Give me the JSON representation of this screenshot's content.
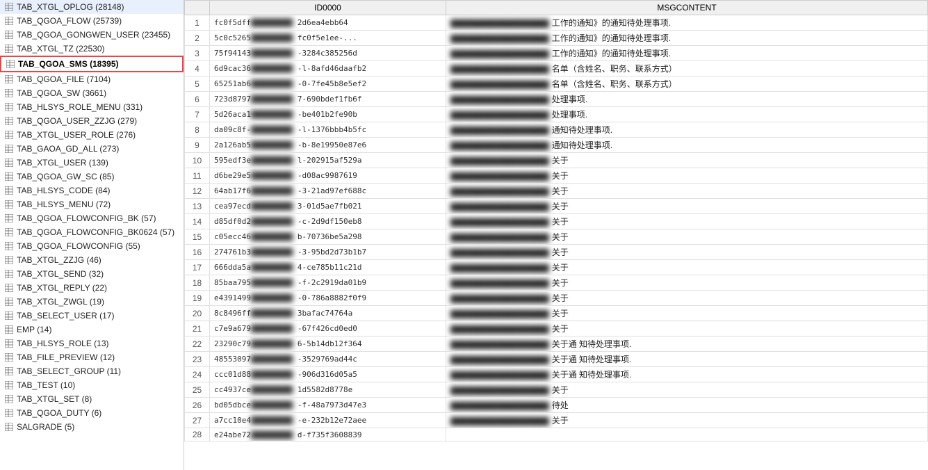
{
  "sidebar": {
    "items": [
      {
        "label": "TAB_XTGL_OPLOG (28148)",
        "selected": false
      },
      {
        "label": "TAB_QGOA_FLOW (25739)",
        "selected": false
      },
      {
        "label": "TAB_QGOA_GONGWEN_USER (23455)",
        "selected": false
      },
      {
        "label": "TAB_XTGL_TZ (22530)",
        "selected": false
      },
      {
        "label": "TAB_QGOA_SMS (18395)",
        "selected": true
      },
      {
        "label": "TAB_QGOA_FILE (7104)",
        "selected": false
      },
      {
        "label": "TAB_QGOA_SW (3661)",
        "selected": false
      },
      {
        "label": "TAB_HLSYS_ROLE_MENU (331)",
        "selected": false
      },
      {
        "label": "TAB_QGOA_USER_ZZJG (279)",
        "selected": false
      },
      {
        "label": "TAB_XTGL_USER_ROLE (276)",
        "selected": false
      },
      {
        "label": "TAB_GAOA_GD_ALL (273)",
        "selected": false
      },
      {
        "label": "TAB_XTGL_USER (139)",
        "selected": false
      },
      {
        "label": "TAB_QGOA_GW_SC (85)",
        "selected": false
      },
      {
        "label": "TAB_HLSYS_CODE (84)",
        "selected": false
      },
      {
        "label": "TAB_HLSYS_MENU (72)",
        "selected": false
      },
      {
        "label": "TAB_QGOA_FLOWCONFIG_BK (57)",
        "selected": false
      },
      {
        "label": "TAB_QGOA_FLOWCONFIG_BK0624 (57)",
        "selected": false
      },
      {
        "label": "TAB_QGOA_FLOWCONFIG (55)",
        "selected": false
      },
      {
        "label": "TAB_XTGL_ZZJG (46)",
        "selected": false
      },
      {
        "label": "TAB_XTGL_SEND (32)",
        "selected": false
      },
      {
        "label": "TAB_XTGL_REPLY (22)",
        "selected": false
      },
      {
        "label": "TAB_XTGL_ZWGL (19)",
        "selected": false
      },
      {
        "label": "TAB_SELECT_USER (17)",
        "selected": false
      },
      {
        "label": "EMP (14)",
        "selected": false
      },
      {
        "label": "TAB_HLSYS_ROLE (13)",
        "selected": false
      },
      {
        "label": "TAB_FILE_PREVIEW (12)",
        "selected": false
      },
      {
        "label": "TAB_SELECT_GROUP (11)",
        "selected": false
      },
      {
        "label": "TAB_TEST (10)",
        "selected": false
      },
      {
        "label": "TAB_XTGL_SET (8)",
        "selected": false
      },
      {
        "label": "TAB_QGOA_DUTY (6)",
        "selected": false
      },
      {
        "label": "SALGRADE (5)",
        "selected": false
      }
    ]
  },
  "table": {
    "columns": [
      "",
      "ID0000",
      "MSGCONTENT"
    ],
    "rows": [
      {
        "num": 1,
        "id": "fc0f5dff-9e...",
        "id_mid": "2d6ea4ebb64",
        "msg_prefix": "工作的通知》的通知待处理事项."
      },
      {
        "num": 2,
        "id": "5c0c5265c6c1",
        "id_mid": "fc0f5e1ee-...",
        "msg_prefix": "工作的通知》的通知待处理事项."
      },
      {
        "num": 3,
        "id": "75f94143-b...",
        "id_mid": "-3284c385256d",
        "msg_prefix": "工作的通知》的通知待处理事项."
      },
      {
        "num": 4,
        "id": "6d9cac36-...",
        "id_mid": "-l-8afd46daafb2",
        "msg_prefix": "名单（含姓名、职务、联系方式）"
      },
      {
        "num": 5,
        "id": "65251ab6-...",
        "id_mid": "-0-7fe45b8e5ef2",
        "msg_prefix": "名单（含姓名、职务、联系方式）"
      },
      {
        "num": 6,
        "id": "723d8797-...",
        "id_mid": "7-690bdef1fb6f",
        "msg_prefix": "处理事项."
      },
      {
        "num": 7,
        "id": "5d26aca1-...",
        "id_mid": "-be401b2fe90b",
        "msg_prefix": "处理事项."
      },
      {
        "num": 8,
        "id": "da09c8f-(...)",
        "id_mid": "-l-1376bbb4b5fc",
        "msg_prefix": "通知待处理事项."
      },
      {
        "num": 9,
        "id": "2a126ab5-...",
        "id_mid": "-b-8e19950e87e6",
        "msg_prefix": "通知待处理事项."
      },
      {
        "num": 10,
        "id": "595edf3e-b...",
        "id_mid": "l-202915af529a",
        "msg_prefix": "关于"
      },
      {
        "num": 11,
        "id": "d6be29e5-...",
        "id_mid": "-d08ac9987619",
        "msg_prefix": "关于"
      },
      {
        "num": 12,
        "id": "64ab17f6-l...",
        "id_mid": "-3-21ad97ef688c",
        "msg_prefix": "关于"
      },
      {
        "num": 13,
        "id": "cea97ecd-...",
        "id_mid": "3-01d5ae7fb021",
        "msg_prefix": "关于"
      },
      {
        "num": 14,
        "id": "d85df0d2-...",
        "id_mid": "-c-2d9df150eb8",
        "msg_prefix": "关于"
      },
      {
        "num": 15,
        "id": "c05ecc46-9...",
        "id_mid": "b-70736be5a298",
        "msg_prefix": "关于"
      },
      {
        "num": 16,
        "id": "274761b3-...",
        "id_mid": "-3-95bd2d73b1b7",
        "msg_prefix": "关于"
      },
      {
        "num": 17,
        "id": "666dda5a-...",
        "id_mid": "4-ce785b11c21d",
        "msg_prefix": "关于"
      },
      {
        "num": 18,
        "id": "85baa795-...",
        "id_mid": "-f-2c2919da01b9",
        "msg_prefix": "关于"
      },
      {
        "num": 19,
        "id": "e4391499-...",
        "id_mid": "-0-786a8882f0f9",
        "msg_prefix": "关于"
      },
      {
        "num": 20,
        "id": "8c8496ff-2...",
        "id_mid": "3bafac74764a",
        "msg_prefix": "关于"
      },
      {
        "num": 21,
        "id": "c7e9a679-...",
        "id_mid": "-67f426cd0ed0",
        "msg_prefix": "关于"
      },
      {
        "num": 22,
        "id": "23290c79-...",
        "id_mid": "6-5b14db12f364",
        "msg_prefix": "关于通 知待处理事项."
      },
      {
        "num": 23,
        "id": "48553097-...",
        "id_mid": "-3529769ad44c",
        "msg_prefix": "关于通 知待处理事项."
      },
      {
        "num": 24,
        "id": "ccc01d88-f...",
        "id_mid": "-906d316d05a5",
        "msg_prefix": "关于通 知待处理事项."
      },
      {
        "num": 25,
        "id": "cc4937ce-4...",
        "id_mid": "1d5582d8778e",
        "msg_prefix": "关于"
      },
      {
        "num": 26,
        "id": "bd05dbce-...",
        "id_mid": "-f-48a7973d47e3",
        "msg_prefix": "待处"
      },
      {
        "num": 27,
        "id": "a7cc10e4-5...",
        "id_mid": "-e-232b12e72aee",
        "msg_prefix": "关于"
      },
      {
        "num": 28,
        "id": "e24abe72-...",
        "id_mid": "d-f735f3608839",
        "msg_prefix": ""
      }
    ]
  }
}
